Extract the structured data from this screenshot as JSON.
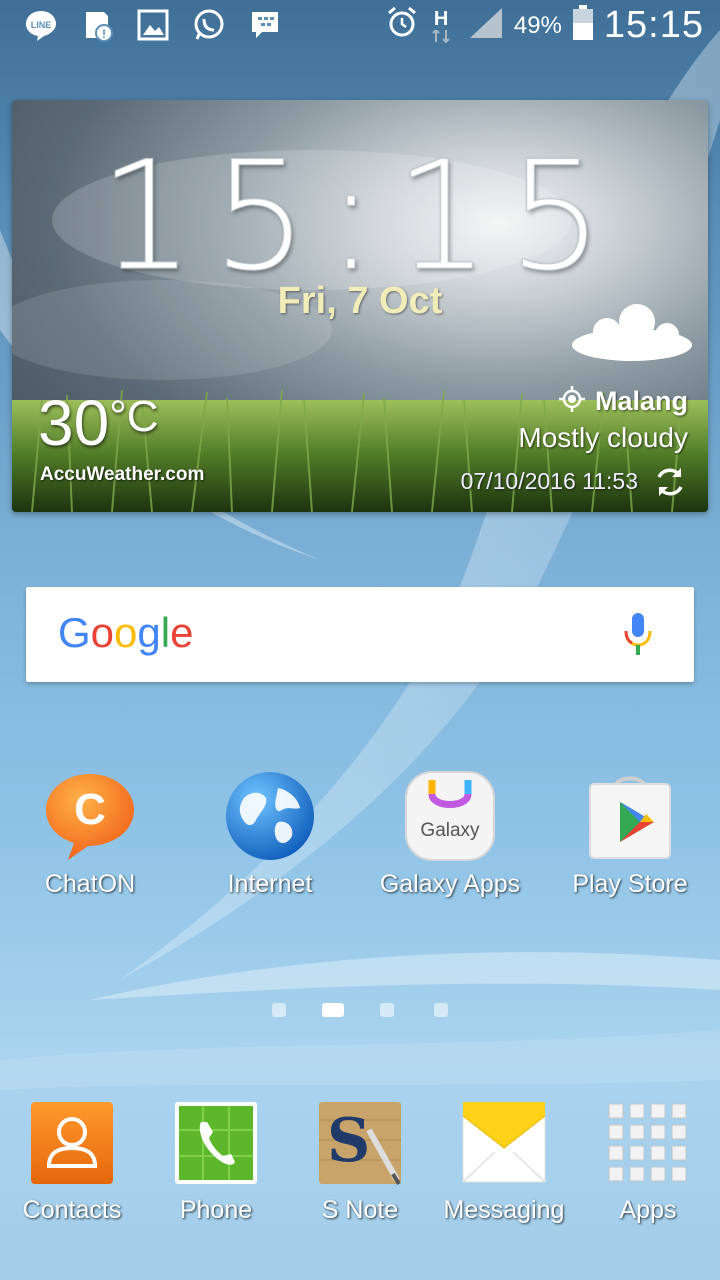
{
  "status_bar": {
    "left_icons": [
      "line-icon",
      "sd-card-alert-icon",
      "gallery-icon",
      "whatsapp-icon",
      "bbm-icon"
    ],
    "right_icons": [
      "alarm-icon",
      "hspa-icon",
      "signal-icon",
      "battery-icon"
    ],
    "network_type": "H",
    "battery_percent": "49%",
    "time": "15:15"
  },
  "widget": {
    "time": "15:15",
    "date": "Fri, 7 Oct",
    "temperature": "30",
    "temperature_unit": "°C",
    "brand": "AccuWeather.com",
    "location": "Malang",
    "condition": "Mostly cloudy",
    "updated": "07/10/2016 11:53"
  },
  "search": {
    "logo_letters": [
      "G",
      "o",
      "o",
      "g",
      "l",
      "e"
    ],
    "logo_colors": [
      "#4285F4",
      "#EA4335",
      "#FBBC05",
      "#4285F4",
      "#34A853",
      "#EA4335"
    ]
  },
  "apps": [
    {
      "label": "ChatON",
      "icon": "chaton-icon"
    },
    {
      "label": "Internet",
      "icon": "globe-icon"
    },
    {
      "label": "Galaxy Apps",
      "icon": "galaxy-apps-icon",
      "icon_text": "Galaxy"
    },
    {
      "label": "Play Store",
      "icon": "play-store-icon"
    }
  ],
  "pager": {
    "count": 4,
    "active": 2
  },
  "dock": [
    {
      "label": "Contacts",
      "icon": "contacts-icon"
    },
    {
      "label": "Phone",
      "icon": "phone-icon"
    },
    {
      "label": "S Note",
      "icon": "s-note-icon",
      "icon_text": "S"
    },
    {
      "label": "Messaging",
      "icon": "messaging-icon"
    },
    {
      "label": "Apps",
      "icon": "apps-grid-icon"
    }
  ]
}
